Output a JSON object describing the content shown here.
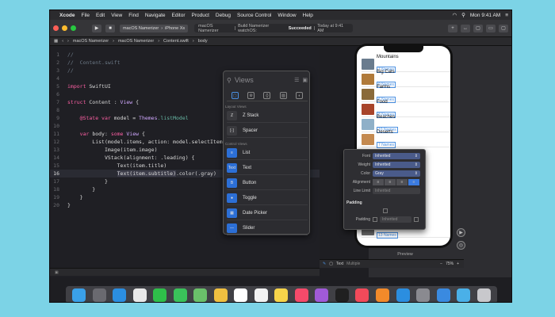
{
  "menubar": {
    "apple": "",
    "app": "Xcode",
    "items": [
      "File",
      "Edit",
      "View",
      "Find",
      "Navigate",
      "Editor",
      "Product",
      "Debug",
      "Source Control",
      "Window",
      "Help"
    ],
    "clock": "Mon 9:41 AM"
  },
  "toolbar": {
    "scheme": "macOS Namerizer",
    "device": "iPhone Xs",
    "status_project": "macOS Namerizer",
    "status_build": "Build Namerizer watchOS:",
    "status_result": "Succeeded",
    "status_time": "Today at 9:41 AM"
  },
  "jumpbar": {
    "items": [
      "macOS Namerizer",
      "macOS Namerizer",
      "Content.swift",
      "body"
    ]
  },
  "editor": {
    "line_numbers": [
      "1",
      "2",
      "3",
      "4",
      "5",
      "6",
      "7",
      "8",
      "9",
      "10",
      "11",
      "12",
      "13",
      "14",
      "15",
      "16",
      "17",
      "18",
      "19",
      "20"
    ],
    "l1": "//",
    "l2": "//  Content.swift",
    "l3": "//",
    "l5a": "import",
    "l5b": " SwiftUI",
    "l7a": "struct",
    "l7b": " Content",
    "l7c": " : ",
    "l7d": "View",
    "l7e": " {",
    "l9a": "    @State",
    "l9b": " var",
    "l9c": " model = ",
    "l9d": "Themes",
    "l9e": ".listModel",
    "l11a": "    var",
    "l11b": " body: ",
    "l11c": "some",
    "l11d": " View",
    "l11e": " {",
    "l12": "        List(model.items, action: model.selectItem) {",
    "l13": "            Image(item.image)",
    "l14": "            VStack(alignment: .leading) {",
    "l15": "                Text(item.title)",
    "l16a": "                ",
    "l16b": "Text(item.subtitle)",
    "l16c": ".color(.gray)",
    "l17": "            }",
    "l18": "        }",
    "l19": "    }",
    "l20": "}"
  },
  "library": {
    "search_placeholder": "Views",
    "section_layout": "Layout Views",
    "section_control": "Control Views",
    "items": [
      {
        "label": "Z Stack",
        "icon": "Z",
        "color": "#3a3a3e"
      },
      {
        "label": "Spacer",
        "icon": "[·]",
        "color": "#3a3a3e"
      },
      {
        "label": "List",
        "icon": "≡",
        "color": "#2c6fd6"
      },
      {
        "label": "Text",
        "icon": "Text",
        "color": "#2c6fd6"
      },
      {
        "label": "Button",
        "icon": "B",
        "color": "#2c6fd6"
      },
      {
        "label": "Toggle",
        "icon": "●",
        "color": "#2c6fd6"
      },
      {
        "label": "Date Picker",
        "icon": "▦",
        "color": "#2c6fd6"
      },
      {
        "label": "Slider",
        "icon": "—",
        "color": "#2c6fd6"
      }
    ]
  },
  "preview": {
    "label": "Preview",
    "rows": [
      {
        "title": "Mountains",
        "subtitle": "7 Names",
        "color": "#6a7c8e"
      },
      {
        "title": "Big Cats",
        "subtitle": "9 Names",
        "color": "#b07a3a"
      },
      {
        "title": "Farms",
        "subtitle": "6 Names",
        "color": "#8a6a3a"
      },
      {
        "title": "Food",
        "subtitle": "8 Names",
        "color": "#a8442a"
      },
      {
        "title": "Beaches",
        "subtitle": "10 Names",
        "color": "#8fb0c8"
      },
      {
        "title": "Deserts",
        "subtitle": "7 Names",
        "color": "#c48a50"
      },
      {
        "title": "Bridges",
        "subtitle": "13 Names",
        "color": "#6a6a6a"
      }
    ]
  },
  "inspector": {
    "font_label": "Font",
    "font_value": "Inherited",
    "weight_label": "Weight",
    "weight_value": "Inherited",
    "color_label": "Color",
    "color_value": "Gray",
    "alignment_label": "Alignment",
    "line_limit_label": "Line Limit",
    "line_limit_value": "Inherited",
    "padding_section": "Padding",
    "padding_label": "Padding",
    "padding_value": "Inherited"
  },
  "bottombar": {
    "type": "Text",
    "mode": "Multiple",
    "zoom": "75%"
  },
  "dock": {
    "icons": [
      {
        "name": "finder-icon",
        "color": "#3aa0e8"
      },
      {
        "name": "launchpad-icon",
        "color": "#6a6a70"
      },
      {
        "name": "safari-icon",
        "color": "#2b8ee0"
      },
      {
        "name": "photos-icon",
        "color": "#e8e8e8"
      },
      {
        "name": "facetime-icon",
        "color": "#2fbf4a"
      },
      {
        "name": "messages-icon",
        "color": "#3ac25a"
      },
      {
        "name": "maps-icon",
        "color": "#6ac06a"
      },
      {
        "name": "photos-app-icon",
        "color": "#f0c040"
      },
      {
        "name": "calendar-icon",
        "color": "#ffffff"
      },
      {
        "name": "reminders-icon",
        "color": "#f2f2f2"
      },
      {
        "name": "notes-icon",
        "color": "#f7d44a"
      },
      {
        "name": "music-icon",
        "color": "#f54a6a"
      },
      {
        "name": "podcasts-icon",
        "color": "#a05ad8"
      },
      {
        "name": "tv-icon",
        "color": "#202020"
      },
      {
        "name": "news-icon",
        "color": "#f24a5a"
      },
      {
        "name": "books-icon",
        "color": "#f28a2a"
      },
      {
        "name": "app-store-icon",
        "color": "#2b8ee0"
      },
      {
        "name": "system-preferences-icon",
        "color": "#8a8a90"
      },
      {
        "name": "xcode-icon",
        "color": "#3a8ae0"
      },
      {
        "name": "folder-icon",
        "color": "#4ab0e8"
      },
      {
        "name": "trash-icon",
        "color": "#c8c8cc"
      }
    ]
  }
}
